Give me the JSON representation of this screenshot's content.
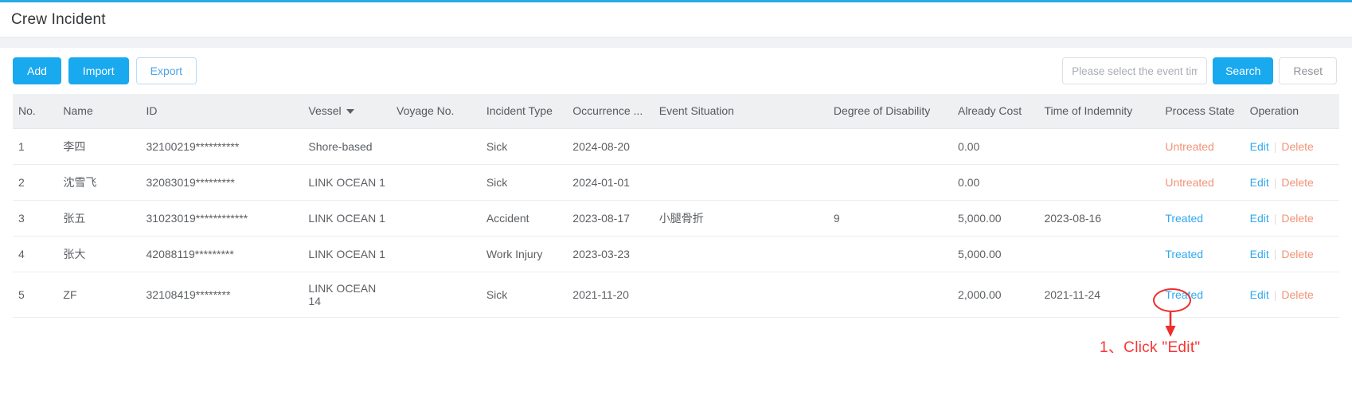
{
  "header": {
    "title": "Crew Incident",
    "accent_color": "#29aae3"
  },
  "toolbar": {
    "add_label": "Add",
    "import_label": "Import",
    "export_label": "Export",
    "search_label": "Search",
    "reset_label": "Reset",
    "date_placeholder": "Please select the event time",
    "date_value": ""
  },
  "table": {
    "columns": [
      {
        "key": "no",
        "label": "No."
      },
      {
        "key": "name",
        "label": "Name"
      },
      {
        "key": "id",
        "label": "ID"
      },
      {
        "key": "vessel",
        "label": "Vessel",
        "sortable": true
      },
      {
        "key": "voyage",
        "label": "Voyage No."
      },
      {
        "key": "incident",
        "label": "Incident Type"
      },
      {
        "key": "occurrence",
        "label": "Occurrence ..."
      },
      {
        "key": "situation",
        "label": "Event Situation"
      },
      {
        "key": "disability",
        "label": "Degree of Disability"
      },
      {
        "key": "cost",
        "label": "Already Cost"
      },
      {
        "key": "indemnity",
        "label": "Time of Indemnity"
      },
      {
        "key": "state",
        "label": "Process State"
      },
      {
        "key": "operation",
        "label": "Operation"
      }
    ],
    "rows": [
      {
        "no": "1",
        "name": "李四",
        "id": "32100219**********",
        "vessel": "Shore-based",
        "voyage": "",
        "incident": "Sick",
        "occurrence": "2024-08-20",
        "situation": "",
        "disability": "",
        "cost": "0.00",
        "indemnity": "",
        "state": "Untreated",
        "state_kind": "untreated"
      },
      {
        "no": "2",
        "name": "沈雪飞",
        "id": "32083019*********",
        "vessel": "LINK OCEAN 1",
        "voyage": "",
        "incident": "Sick",
        "occurrence": "2024-01-01",
        "situation": "",
        "disability": "",
        "cost": "0.00",
        "indemnity": "",
        "state": "Untreated",
        "state_kind": "untreated"
      },
      {
        "no": "3",
        "name": "张五",
        "id": "31023019************",
        "vessel": "LINK OCEAN 1",
        "voyage": "",
        "incident": "Accident",
        "occurrence": "2023-08-17",
        "situation": "小腿骨折",
        "disability": "9",
        "cost": "5,000.00",
        "indemnity": "2023-08-16",
        "state": "Treated",
        "state_kind": "treated"
      },
      {
        "no": "4",
        "name": "张大",
        "id": "42088119*********",
        "vessel": "LINK OCEAN 1",
        "voyage": "",
        "incident": "Work Injury",
        "occurrence": "2023-03-23",
        "situation": "",
        "disability": "",
        "cost": "5,000.00",
        "indemnity": "",
        "state": "Treated",
        "state_kind": "treated"
      },
      {
        "no": "5",
        "name": "ZF",
        "id": "32108419********",
        "vessel": "LINK OCEAN 14",
        "voyage": "",
        "incident": "Sick",
        "occurrence": "2021-11-20",
        "situation": "",
        "disability": "",
        "cost": "2,000.00",
        "indemnity": "2021-11-24",
        "state": "Treated",
        "state_kind": "treated"
      }
    ],
    "row_actions": {
      "edit_label": "Edit",
      "delete_label": "Delete",
      "separator": "|"
    }
  },
  "annotation": {
    "text": "1、Click \"Edit\"",
    "color": "#f73636",
    "target": "Edit"
  }
}
